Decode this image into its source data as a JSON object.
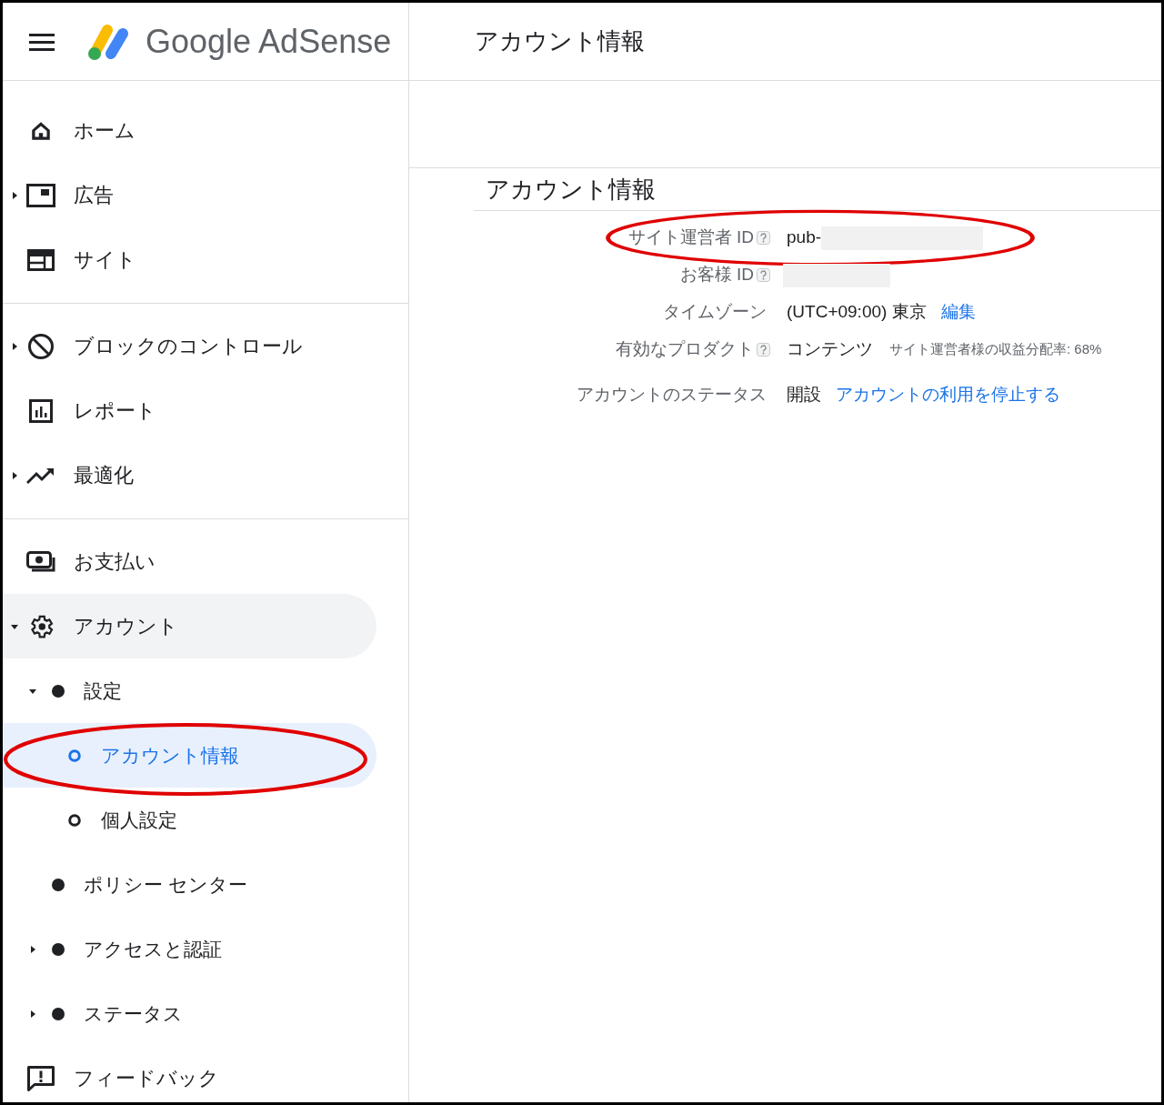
{
  "header": {
    "product": "Google AdSense",
    "title": "アカウント情報"
  },
  "sidebar": {
    "sections": [
      {
        "items": [
          {
            "label": "ホーム",
            "selected": false,
            "highlighted": false
          },
          {
            "label": "広告",
            "expanded": false,
            "selected": false,
            "highlighted": false
          },
          {
            "label": "サイト",
            "selected": false,
            "highlighted": false
          }
        ]
      },
      {
        "items": [
          {
            "label": "ブロックのコントロール",
            "expanded": false,
            "selected": false,
            "highlighted": false
          },
          {
            "label": "レポート",
            "selected": false,
            "highlighted": false
          },
          {
            "label": "最適化",
            "expanded": false,
            "selected": false,
            "highlighted": false
          }
        ]
      },
      {
        "items": [
          {
            "label": "お支払い",
            "selected": false,
            "highlighted": false
          },
          {
            "label": "アカウント",
            "expanded": true,
            "selected": false,
            "highlighted": true,
            "children": [
              {
                "label": "設定",
                "expanded": true,
                "selected": false,
                "circled": false,
                "children": [
                  {
                    "label": "アカウント情報",
                    "selected": true,
                    "circled": true
                  },
                  {
                    "label": "個人設定",
                    "selected": false,
                    "circled": false
                  }
                ]
              },
              {
                "label": "ポリシー センター",
                "selected": false,
                "circled": false
              },
              {
                "label": "アクセスと認証",
                "expanded": false,
                "selected": false,
                "circled": false
              },
              {
                "label": "ステータス",
                "expanded": false,
                "selected": false,
                "circled": false
              }
            ]
          },
          {
            "label": "フィードバック",
            "selected": false,
            "highlighted": false
          }
        ]
      }
    ]
  },
  "card": {
    "title": "アカウント情報",
    "rows": [
      {
        "label": "サイト運営者 ID",
        "help": true,
        "value": "pub-",
        "redacted": true,
        "circled": true
      },
      {
        "label": "お客様 ID",
        "help": true,
        "redacted": true
      },
      {
        "label": "タイムゾーン",
        "value": "(UTC+09:00) 東京",
        "link": "編集"
      },
      {
        "label": "有効なプロダクト",
        "help": true,
        "value": "コンテンツ",
        "note": "サイト運営者様の収益分配率: 68%"
      },
      {
        "label": "アカウントのステータス",
        "value": "開設",
        "link": "アカウントの利用を停止する"
      }
    ]
  }
}
